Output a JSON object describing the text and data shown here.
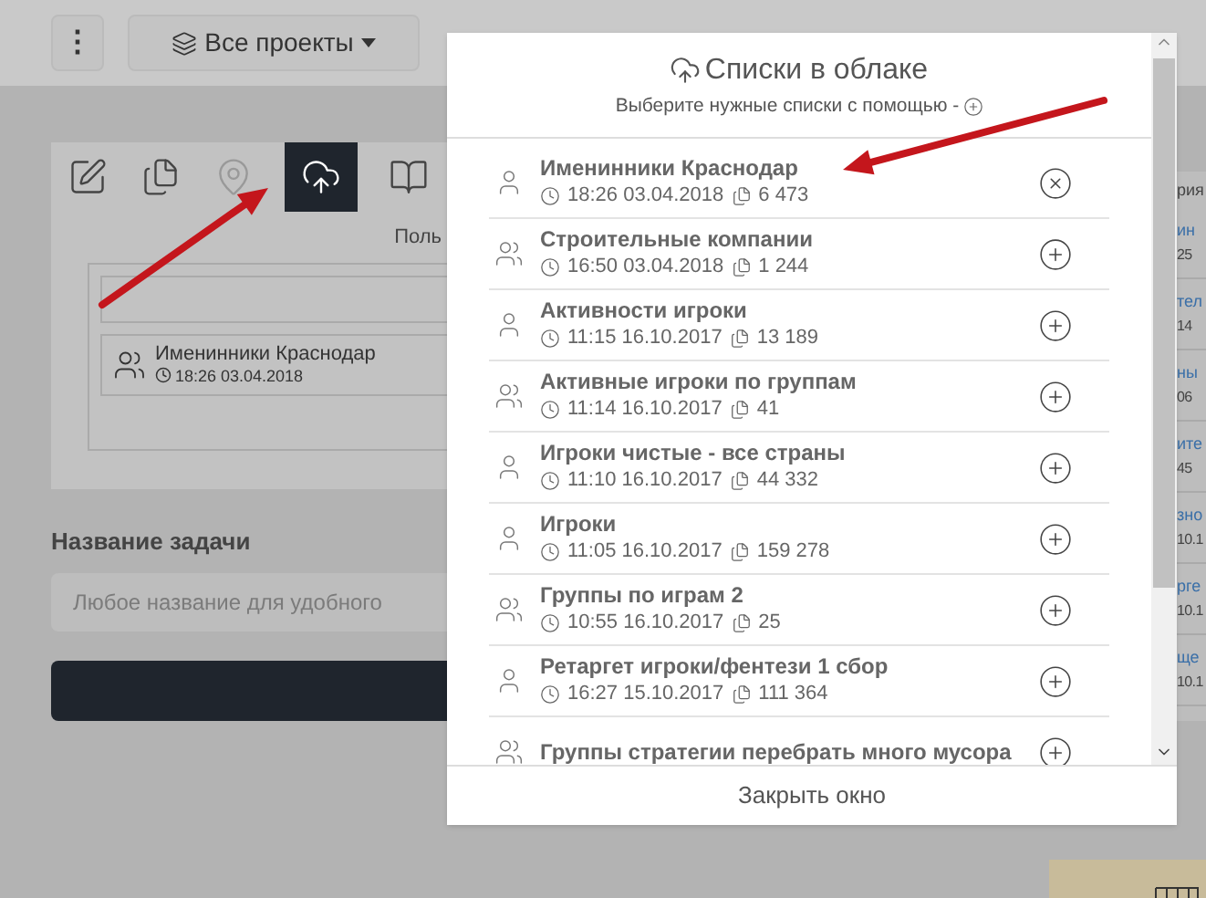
{
  "topbar": {
    "menu_glyph": "⋮",
    "projects_button": "Все проекты"
  },
  "tool_tabs": [
    {
      "kind": "edit",
      "selected": false
    },
    {
      "kind": "copy",
      "selected": false
    },
    {
      "kind": "pin",
      "selected": false
    },
    {
      "kind": "cloud",
      "selected": true
    },
    {
      "kind": "book",
      "selected": false
    }
  ],
  "panel": {
    "caption": "Поль",
    "selected_list": {
      "title": "Именинники Краснодар",
      "time": "18:26 03.04.2018"
    }
  },
  "task": {
    "label": "Название задачи",
    "placeholder": "Любое название для удобного"
  },
  "right_column": {
    "header": "рия",
    "rows": [
      {
        "title": "ин",
        "date": "25"
      },
      {
        "title": "тел",
        "date": "14"
      },
      {
        "title": "ны",
        "date": "06"
      },
      {
        "title": "ите",
        "date": "45"
      },
      {
        "title": "зно",
        "date": "10.1"
      },
      {
        "title": "рге",
        "date": "10.1"
      },
      {
        "title": "ще",
        "date": "10.1"
      }
    ]
  },
  "modal": {
    "title": "Списки в облаке",
    "subtitle": "Выберите нужные списки с помощью -",
    "close_button": "Закрыть окно",
    "items": [
      {
        "kind": "single",
        "title": "Именинники Краснодар",
        "time": "18:26 03.04.2018",
        "count": "6 473",
        "selected": true
      },
      {
        "kind": "group",
        "title": "Строительные компании",
        "time": "16:50 03.04.2018",
        "count": "1 244",
        "selected": false
      },
      {
        "kind": "single",
        "title": "Активности игроки",
        "time": "11:15 16.10.2017",
        "count": "13 189",
        "selected": false
      },
      {
        "kind": "group",
        "title": "Активные игроки по группам",
        "time": "11:14 16.10.2017",
        "count": "41",
        "selected": false
      },
      {
        "kind": "single",
        "title": "Игроки чистые - все страны",
        "time": "11:10 16.10.2017",
        "count": "44 332",
        "selected": false
      },
      {
        "kind": "single",
        "title": "Игроки",
        "time": "11:05 16.10.2017",
        "count": "159 278",
        "selected": false
      },
      {
        "kind": "group",
        "title": "Группы по играм 2",
        "time": "10:55 16.10.2017",
        "count": "25",
        "selected": false
      },
      {
        "kind": "single",
        "title": "Ретаргет игроки/фентези 1 сбор",
        "time": "16:27 15.10.2017",
        "count": "111 364",
        "selected": false
      },
      {
        "kind": "group",
        "title": "Группы стратегии перебрать много мусора",
        "selected": false
      }
    ]
  }
}
